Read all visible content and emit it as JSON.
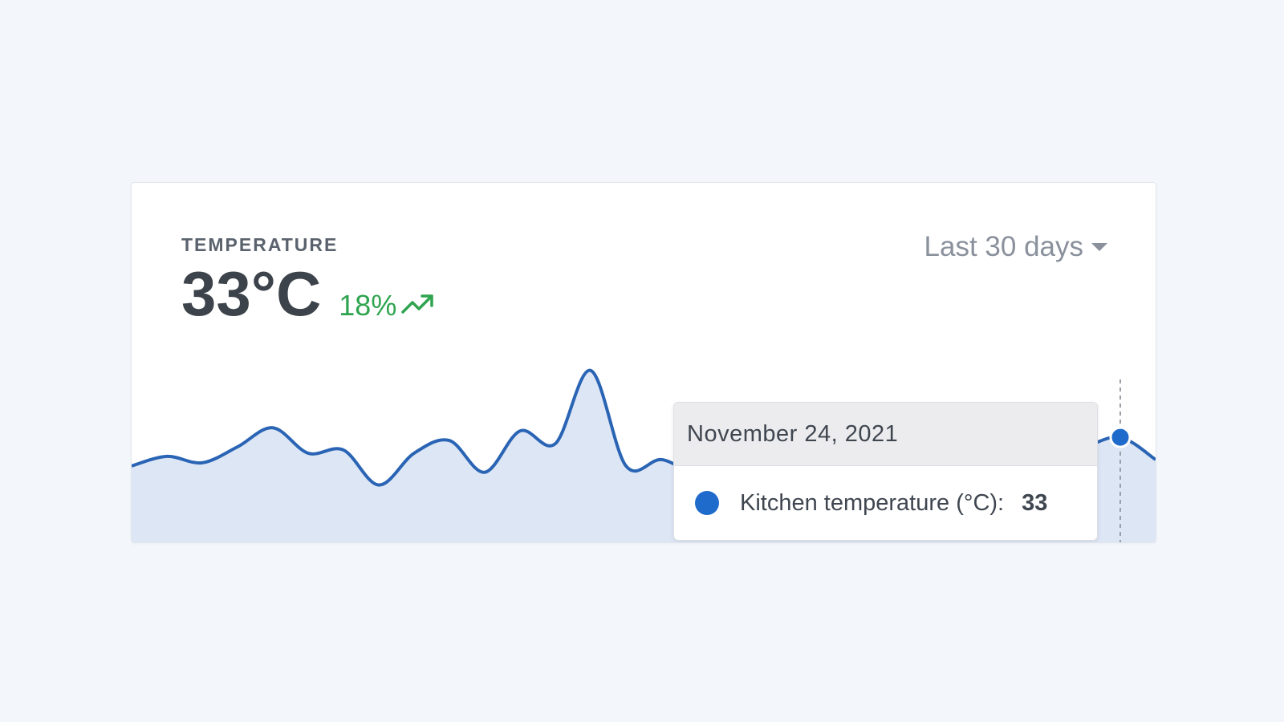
{
  "widget": {
    "label": "TEMPERATURE",
    "value": "33°C",
    "change": "18%",
    "trend_icon": "trending-up-icon",
    "range_label": "Last 30 days"
  },
  "tooltip": {
    "date": "November 24, 2021",
    "series_name": "Kitchen temperature (°C):",
    "value": "33"
  },
  "colors": {
    "line": "#2a64b4",
    "area": "#dde6f5",
    "positive": "#2ea44f",
    "marker": "#1f6bcb"
  },
  "chart_data": {
    "type": "area",
    "series": [
      {
        "name": "Kitchen temperature (°C)",
        "values": [
          24,
          27,
          25,
          30,
          36,
          28,
          29,
          18,
          28,
          32,
          22,
          35,
          31,
          54,
          24,
          26,
          22,
          28,
          30,
          24,
          27,
          33,
          29,
          26,
          30,
          33,
          27,
          30,
          33,
          26
        ]
      }
    ],
    "highlighted_index": 28,
    "highlighted_label": "November 24, 2021",
    "ylim": [
      0,
      60
    ],
    "grid": false,
    "axes": false
  }
}
